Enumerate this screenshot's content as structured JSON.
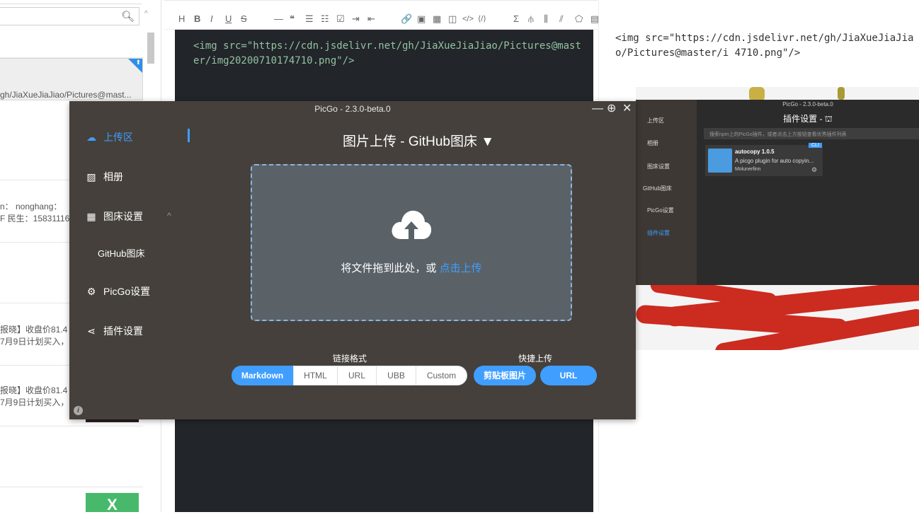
{
  "note_list": {
    "snippets": [
      "gh/JiaXueJiaJiao/Pictures@mast...",
      "n： nonghang：",
      "F 民生：15831116",
      "报晓】收盘价81.4",
      "7月9日计划买入，",
      "报晓】收盘价81.4",
      "7月9日计划买入，"
    ],
    "pin_glyph": "⬆"
  },
  "toolbar": {
    "items": [
      "H",
      "B",
      "I",
      "U",
      "S",
      "—",
      "❝",
      "☰",
      "☷",
      "☑",
      "⇥",
      "⇤",
      "🔗",
      "▣",
      "▦",
      "◫",
      "</>",
      "⟨/⟩",
      "Σ",
      "⫛",
      "⫼",
      "⫽",
      "⬠",
      "▤",
      "?"
    ]
  },
  "editor": {
    "content": "<img src=\"https://cdn.jsdelivr.net/gh/JiaXueJiaJiao/Pictures@master/img20200710174710.png\"/>"
  },
  "preview": {
    "content": "<img src=\"https://cdn.jsdelivr.net/gh/JiaXueJiaJiao/Pictures@master/i 4710.png\"/>",
    "embedded": {
      "title": "PicGo - 2.3.0-beta.0",
      "heading": "插件设置 - ⛫",
      "search_placeholder": "搜索npm上的PicGo插件，或者点击上方按钮查看优秀插件列表",
      "side_items": [
        "上传区",
        "相册",
        "图床设置",
        "GitHub图床",
        "PicGo设置",
        "插件设置"
      ],
      "plugin": {
        "name": "autocopy 1.0.5",
        "desc": "A picgo plugin for auto copyin...",
        "author": "Molunerfinn",
        "badge": "CLI"
      }
    }
  },
  "picgo": {
    "title": "PicGo - 2.3.0-beta.0",
    "heading": "图片上传 - GitHub图床 ▼",
    "nav": [
      {
        "label": "上传区",
        "icon": "cloud-upload-icon",
        "glyph": "☁",
        "active": true
      },
      {
        "label": "相册",
        "icon": "gallery-icon",
        "glyph": "▨"
      },
      {
        "label": "图床设置",
        "icon": "grid-icon",
        "glyph": "▦",
        "caret": "^"
      },
      {
        "label": "GitHub图床",
        "icon": "",
        "glyph": ""
      },
      {
        "label": "PicGo设置",
        "icon": "gear-icon",
        "glyph": "⚙"
      },
      {
        "label": "插件设置",
        "icon": "share-icon",
        "glyph": "⋖"
      }
    ],
    "drop_text": "将文件拖到此处，或 ",
    "drop_link": "点击上传",
    "link_format_label": "链接格式",
    "quick_upload_label": "快捷上传",
    "formats": [
      "Markdown",
      "HTML",
      "URL",
      "UBB",
      "Custom"
    ],
    "active_format": "Markdown",
    "quick_buttons": [
      "剪贴板图片",
      "URL"
    ],
    "window_buttons": {
      "minimize": "—",
      "maximize": "⊕",
      "close": "✕"
    },
    "info": "i"
  }
}
